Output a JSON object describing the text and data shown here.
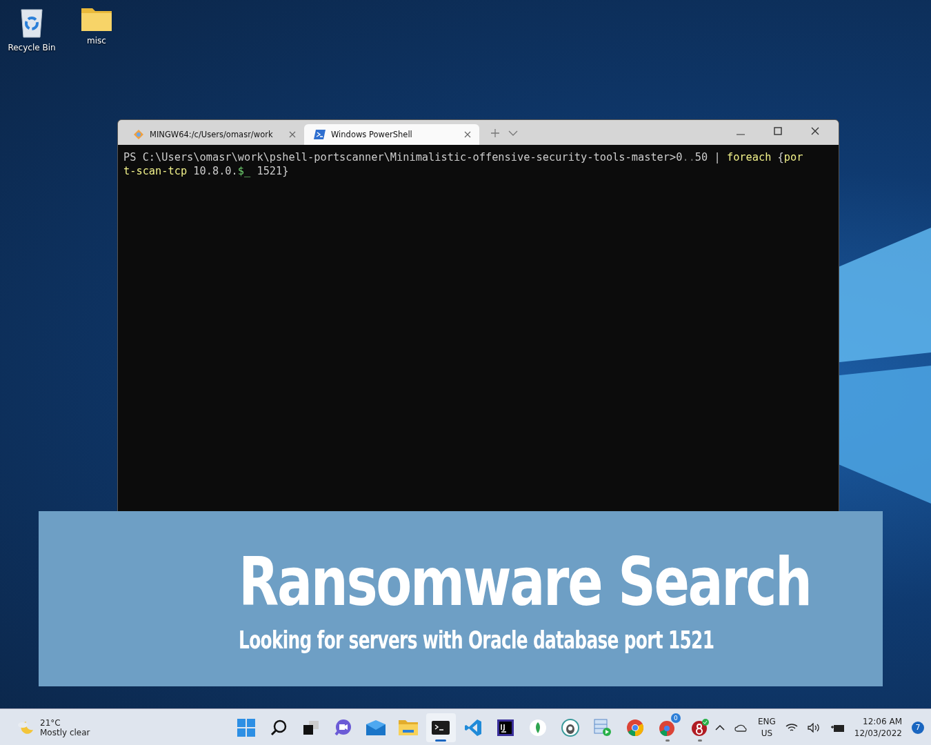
{
  "desktop_icons": [
    {
      "kind": "recycle-bin",
      "label": "Recycle Bin"
    },
    {
      "kind": "folder",
      "label": "misc"
    }
  ],
  "terminal": {
    "tabs": [
      {
        "kind": "git",
        "title": "MINGW64:/c/Users/omasr/work",
        "selected": false
      },
      {
        "kind": "powershell",
        "title": "Windows PowerShell",
        "selected": true
      }
    ],
    "lines": [
      [
        {
          "kind": "plain",
          "text": "PS C:\\Users\\omasr\\work\\pshell-portscanner\\Minimalistic-offensive-security-tools-master>0"
        },
        {
          "kind": "dim",
          "text": ".."
        },
        {
          "kind": "plain",
          "text": "50 | "
        },
        {
          "kind": "command",
          "text": "foreach"
        },
        {
          "kind": "plain",
          "text": " {"
        },
        {
          "kind": "command",
          "text": "por"
        }
      ],
      [
        {
          "kind": "command",
          "text": "t-scan-tcp"
        },
        {
          "kind": "plain",
          "text": " 10.8.0."
        },
        {
          "kind": "variable",
          "text": "$_"
        },
        {
          "kind": "plain",
          "text": " 1521}"
        }
      ]
    ]
  },
  "banner": {
    "title": "Ransomware Search",
    "subtitle": "Looking for servers with Oracle database port 1521"
  },
  "taskbar": {
    "weather": {
      "temperature": "21°C",
      "condition": "Mostly clear"
    },
    "apps": [
      {
        "kind": "start",
        "selected": false,
        "running": false
      },
      {
        "kind": "search",
        "selected": false,
        "running": false
      },
      {
        "kind": "task-view",
        "selected": false,
        "running": false
      },
      {
        "kind": "chat",
        "selected": false,
        "running": false
      },
      {
        "kind": "mail",
        "selected": false,
        "running": false
      },
      {
        "kind": "explorer",
        "selected": false,
        "running": false
      },
      {
        "kind": "terminal",
        "selected": true,
        "running": true
      },
      {
        "kind": "code",
        "selected": false,
        "running": false
      },
      {
        "kind": "ij",
        "selected": false,
        "running": false
      },
      {
        "kind": "leaf",
        "selected": false,
        "running": false
      },
      {
        "kind": "dog",
        "selected": false,
        "running": false
      },
      {
        "kind": "server",
        "selected": false,
        "running": false
      },
      {
        "kind": "chrome",
        "selected": false,
        "running": false
      },
      {
        "kind": "chrome-multi",
        "selected": false,
        "running": true,
        "badge": "0"
      },
      {
        "kind": "red-app",
        "selected": false,
        "running": true
      }
    ],
    "language": "ENG",
    "region": "US",
    "time": "12:06 AM",
    "date": "12/03/2022",
    "notifications": "7"
  }
}
